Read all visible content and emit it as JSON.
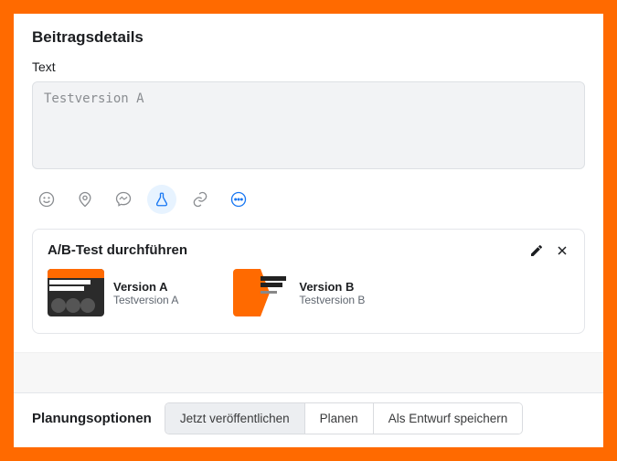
{
  "header": {
    "title": "Beitragsdetails"
  },
  "text_field": {
    "label": "Text",
    "value": "Testversion A"
  },
  "toolbar": {
    "emoji": "emoji-icon",
    "location": "location-icon",
    "messenger": "messenger-icon",
    "flask": "flask-icon",
    "link": "link-icon",
    "more": "more-icon"
  },
  "ab_test": {
    "title": "A/B-Test durchführen",
    "versions": [
      {
        "title": "Version A",
        "subtitle": "Testversion A"
      },
      {
        "title": "Version B",
        "subtitle": "Testversion B"
      }
    ]
  },
  "footer": {
    "title": "Planungsoptionen",
    "options": {
      "publish_now": "Jetzt veröffentlichen",
      "schedule": "Planen",
      "save_draft": "Als Entwurf speichern"
    }
  }
}
